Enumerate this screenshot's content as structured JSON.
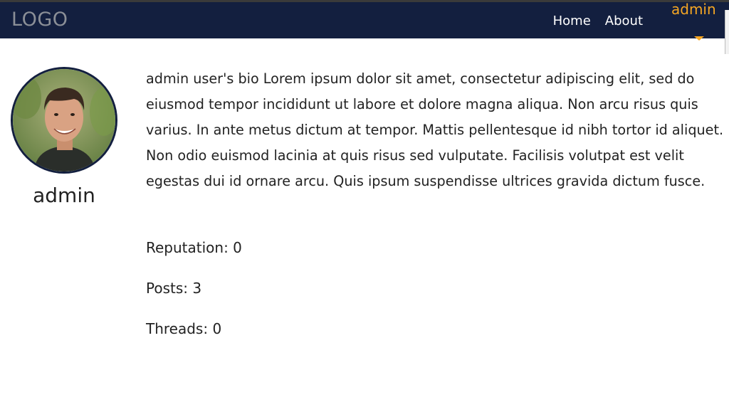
{
  "header": {
    "logo": "LOGO",
    "nav": [
      {
        "label": "Home"
      },
      {
        "label": "About"
      }
    ],
    "user_menu": {
      "username": "admin",
      "caret_icon": "caret-down-icon"
    }
  },
  "profile": {
    "avatar_icon": "user-avatar-photo",
    "name": "admin",
    "bio": "admin user's bio Lorem ipsum dolor sit amet, consectetur adipiscing elit, sed do eiusmod tempor incididunt ut labore et dolore magna aliqua. Non arcu risus quis varius. In ante metus dictum at tempor. Mattis pellentesque id nibh tortor id aliquet. Non odio euismod lacinia at quis risus sed vulputate. Facilisis volutpat est velit egestas dui id ornare arcu. Quis ipsum suspendisse ultrices gravida dictum fusce.",
    "stats": {
      "reputation": "Reputation: 0",
      "posts": "Posts: 3",
      "threads": "Threads: 0"
    }
  },
  "colors": {
    "header_bg": "#131f3f",
    "accent": "#f5a623",
    "logo": "#8b8f97"
  }
}
